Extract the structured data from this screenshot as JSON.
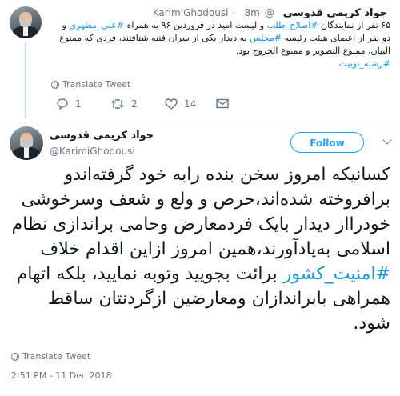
{
  "tweet1": {
    "display_name": "جواد کریمی قدوسی",
    "handle": "@KarimiGhodousi",
    "time_sep": "·",
    "time": "8m",
    "text_a": "۶۵ نفر از نمایندگان ",
    "hashtag1": "#اصلاح_طلب",
    "text_b": " و لیست امید در فروردین ۹۶ به همراه ",
    "hashtag2": "#علی_مطهری",
    "text_c": " و دو نفر از اعضای هیئت رئیسه ",
    "hashtag3": "#مجلس",
    "text_d": " به دیدار یکی از سران فتنه شتافتند، فردی که ممنوع البیان، ممنوع التصویر و ممنوع الخروج بود.",
    "hashtag4": "#رشته_توییت",
    "translate": "Translate Tweet",
    "replies": "1",
    "retweets": "2",
    "likes": "14"
  },
  "tweet2": {
    "display_name": "جواد کریمی قدوسی",
    "handle": "@KarimiGhodousi",
    "follow": "Follow",
    "text_a": "کسانیکه امروز سخن بنده رابه خود گرفته‌اندو برافروخته شده‌اند،حرص و ولع و شعف وسرخوشی خودرااز دیدار بایک فردمعارض وحامی براندازی نظام اسلامی به‌یادآورند،همین امروز ازاین اقدام خلاف ",
    "hashtag": "#امنیت_کشور",
    "text_b": " برائت بجویید وتوبه نمایید، بلکه اتهام همراهی بابراندازان ومعارضین ازگردنتان ساقط شود.",
    "translate": "Translate Tweet",
    "timestamp": "2:51 PM - 11 Dec 2018"
  },
  "colors": {
    "accent": "#1da1f2",
    "link": "#1b95e0",
    "muted": "#657786"
  }
}
